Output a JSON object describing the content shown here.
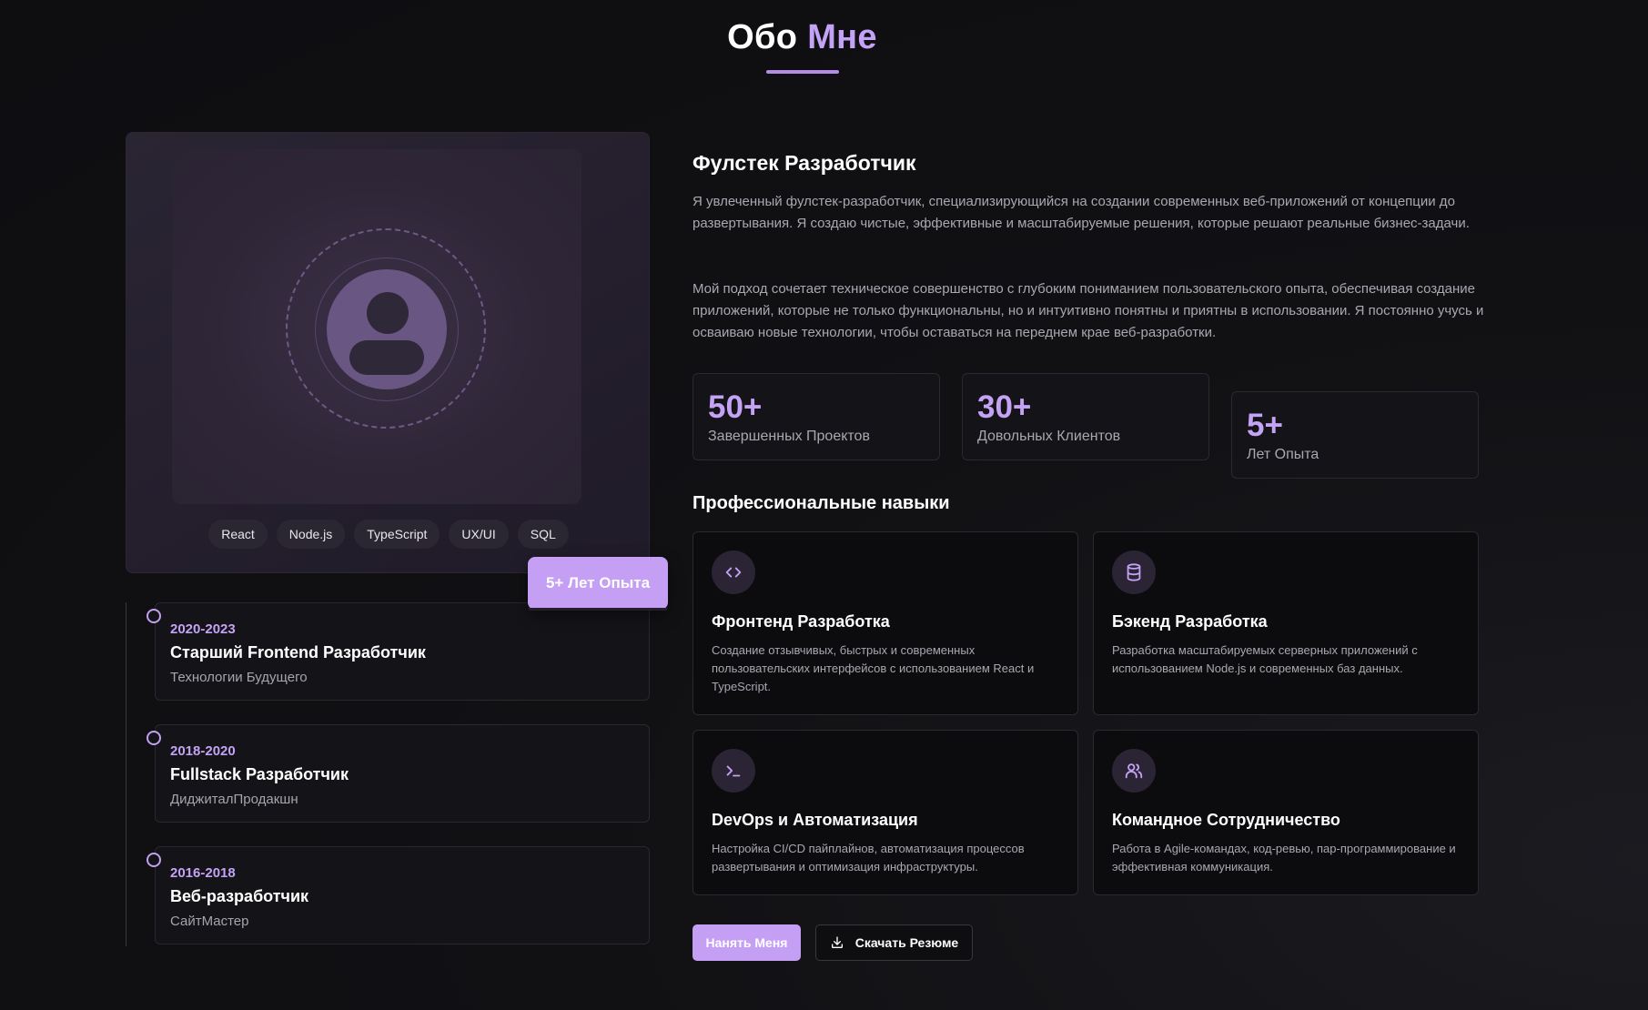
{
  "header": {
    "title_part1": "Обо",
    "title_part2": "Мне"
  },
  "profile": {
    "tech_tags": [
      "React",
      "Node.js",
      "TypeScript",
      "UX/UI",
      "SQL"
    ],
    "experience_badge": "5+ Лет Опыта"
  },
  "timeline": [
    {
      "period": "2020-2023",
      "role": "Старший Frontend Разработчик",
      "company": "Технологии Будущего"
    },
    {
      "period": "2018-2020",
      "role": "Fullstack Разработчик",
      "company": "ДиджиталПродакшн"
    },
    {
      "period": "2016-2018",
      "role": "Веб-разработчик",
      "company": "СайтМастер"
    }
  ],
  "about": {
    "role_title": "Фулстек Разработчик",
    "paragraph1": "Я увлеченный фулстек-разработчик, специализирующийся на создании современных веб-приложений от концепции до развертывания. Я создаю чистые, эффективные и масштабируемые решения, которые решают реальные бизнес-задачи.",
    "paragraph2": "Мой подход сочетает техническое совершенство с глубоким пониманием пользовательского опыта, обеспечивая создание приложений, которые не только функциональны, но и интуитивно понятны и приятны в использовании. Я постоянно учусь и осваиваю новые технологии, чтобы оставаться на переднем крае веб-разработки."
  },
  "stats": [
    {
      "value": "50+",
      "label": "Завершенных Проектов"
    },
    {
      "value": "30+",
      "label": "Довольных Клиентов"
    },
    {
      "value": "5+",
      "label": "Лет Опыта"
    }
  ],
  "skills": {
    "title": "Профессиональные навыки",
    "items": [
      {
        "icon": "code-icon",
        "name": "Фронтенд Разработка",
        "description": "Создание отзывчивых, быстрых и современных пользовательских интерфейсов с использованием React и TypeScript."
      },
      {
        "icon": "database-icon",
        "name": "Бэкенд Разработка",
        "description": "Разработка масштабируемых серверных приложений с использованием Node.js и современных баз данных."
      },
      {
        "icon": "terminal-icon",
        "name": "DevOps и Автоматизация",
        "description": "Настройка CI/CD пайплайнов, автоматизация процессов развертывания и оптимизация инфраструктуры."
      },
      {
        "icon": "users-icon",
        "name": "Командное Сотрудничество",
        "description": "Работа в Agile-командах, код-ревью, пар-программирование и эффективная коммуникация."
      }
    ]
  },
  "actions": {
    "hire_label": "Нанять Меня",
    "resume_label": "Скачать Резюме",
    "resume_icon": "download-icon"
  },
  "colors": {
    "accent": "#c4a2f5",
    "background": "#0f0f12",
    "card": "#141317"
  }
}
